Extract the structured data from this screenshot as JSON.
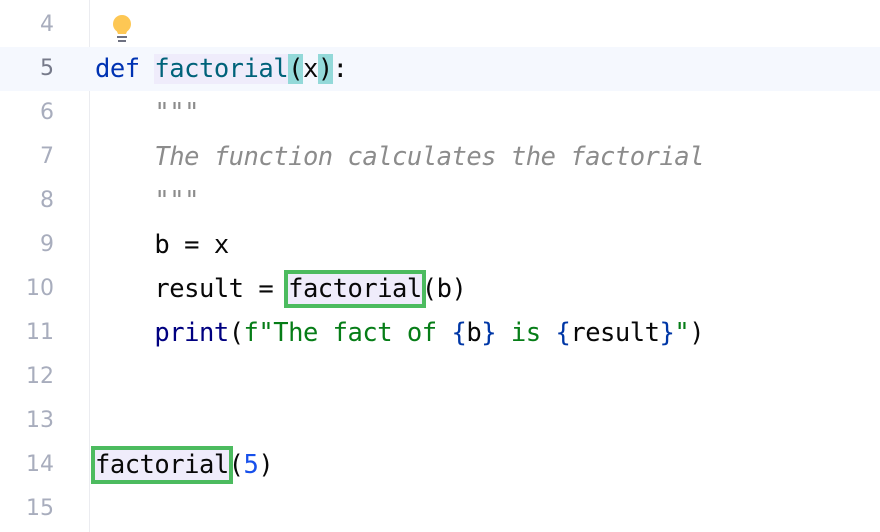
{
  "editor": {
    "language": "python",
    "current_line": 5,
    "intention_icon": "lightbulb-icon",
    "lines": [
      {
        "number": "4",
        "indent": "",
        "tokens": []
      },
      {
        "number": "5",
        "indent": "",
        "tokens": [
          {
            "t": "def",
            "c": "kw"
          },
          {
            "t": " "
          },
          {
            "t": "factorial",
            "c": "fn-def"
          },
          {
            "t": "(",
            "c": "brace-match"
          },
          {
            "t": "x"
          },
          {
            "t": ")",
            "c": "brace-match"
          },
          {
            "t": ":"
          }
        ]
      },
      {
        "number": "6",
        "indent": "    ",
        "tokens": [
          {
            "t": "\"\"\"",
            "c": "doc"
          }
        ]
      },
      {
        "number": "7",
        "indent": "    ",
        "tokens": [
          {
            "t": "The function calculates the factorial",
            "c": "doc"
          }
        ]
      },
      {
        "number": "8",
        "indent": "    ",
        "tokens": [
          {
            "t": "\"\"\"",
            "c": "doc"
          }
        ]
      },
      {
        "number": "9",
        "indent": "    ",
        "tokens": [
          {
            "t": "b = x"
          }
        ]
      },
      {
        "number": "10",
        "indent": "    ",
        "tokens": [
          {
            "t": "result = "
          },
          {
            "t": "factorial",
            "c": "usage"
          },
          {
            "t": "(b)"
          }
        ]
      },
      {
        "number": "11",
        "indent": "    ",
        "tokens": [
          {
            "t": "print",
            "c": "builtin"
          },
          {
            "t": "("
          },
          {
            "t": "f\"The fact of ",
            "c": "str"
          },
          {
            "t": "{",
            "c": "fmt"
          },
          {
            "t": "b"
          },
          {
            "t": "}",
            "c": "fmt"
          },
          {
            "t": " is ",
            "c": "str"
          },
          {
            "t": "{",
            "c": "fmt"
          },
          {
            "t": "result"
          },
          {
            "t": "}",
            "c": "fmt"
          },
          {
            "t": "\"",
            "c": "str"
          },
          {
            "t": ")"
          }
        ]
      },
      {
        "number": "12",
        "indent": "",
        "tokens": []
      },
      {
        "number": "13",
        "indent": "",
        "tokens": []
      },
      {
        "number": "14",
        "indent": "",
        "tokens": [
          {
            "t": "factorial",
            "c": "usage"
          },
          {
            "t": "("
          },
          {
            "t": "5",
            "c": "num"
          },
          {
            "t": ")"
          }
        ]
      },
      {
        "number": "15",
        "indent": "",
        "tokens": []
      }
    ]
  }
}
